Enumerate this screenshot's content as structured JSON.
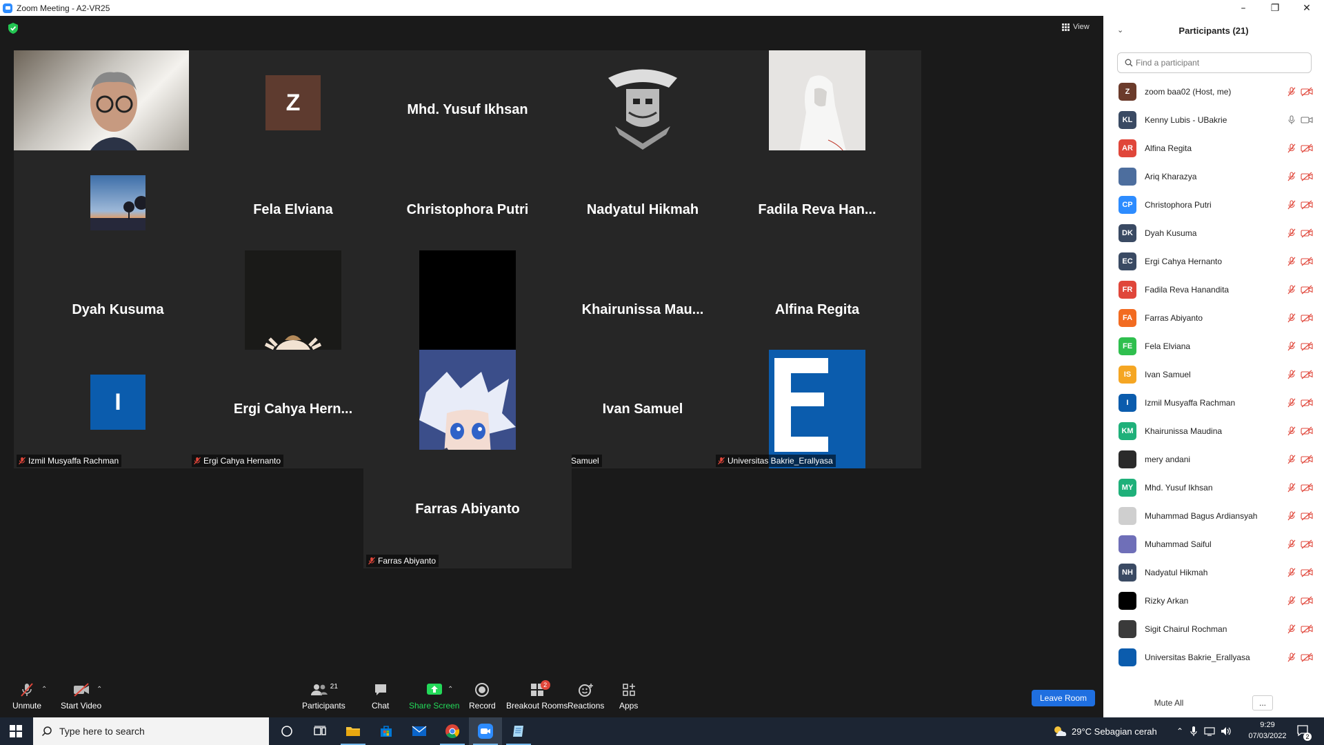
{
  "window": {
    "title": "Zoom Meeting - A2-VR25",
    "controls": [
      "minimize",
      "restore",
      "close"
    ]
  },
  "meeting": {
    "view_label": "View",
    "tiles": [
      {
        "label": "Kenny Lubis - UBakrie",
        "type": "video",
        "active": true,
        "muted": false
      },
      {
        "label": "zoom baa02",
        "type": "letter",
        "letter": "Z",
        "bg": "#5e3b2f",
        "muted": true
      },
      {
        "label": "Mhd. Yusuf Ikhsan",
        "type": "name",
        "display": "Mhd. Yusuf Ikhsan",
        "muted": true
      },
      {
        "label": "Sigit Chairul Rochman",
        "type": "image",
        "image": "samurai-emblem",
        "muted": true
      },
      {
        "label": "Muhammad Bagus Ardiansyah",
        "type": "image",
        "image": "hooded-figure",
        "muted": true
      },
      {
        "label": "Ariq Kharazya",
        "type": "image",
        "image": "sunset-tree",
        "muted": true
      },
      {
        "label": "Fela Elviana",
        "type": "name",
        "display": "Fela Elviana",
        "muted": true
      },
      {
        "label": "Christophora Putri",
        "type": "name",
        "display": "Christophora Putri",
        "muted": true
      },
      {
        "label": "Nadyatul Hikmah",
        "type": "name",
        "display": "Nadyatul Hikmah",
        "muted": true
      },
      {
        "label": "Fadila Reva Hanandita",
        "type": "name",
        "display": "Fadila Reva Han...",
        "muted": true
      },
      {
        "label": "Dyah Kusuma",
        "type": "name",
        "display": "Dyah Kusuma",
        "muted": true
      },
      {
        "label": "mery andani",
        "type": "image",
        "image": "person-selfie",
        "muted": true
      },
      {
        "label": "Rizky Arkan",
        "type": "image",
        "image": "black",
        "muted": true
      },
      {
        "label": "Khairunissa Maudina",
        "type": "name",
        "display": "Khairunissa  Mau...",
        "muted": true
      },
      {
        "label": "Alfina Regita",
        "type": "name",
        "display": "Alfina Regita",
        "muted": true
      },
      {
        "label": "Izmil Musyaffa Rachman",
        "type": "letter",
        "letter": "I",
        "bg": "#0b5cad",
        "muted": true
      },
      {
        "label": "Ergi Cahya Hernanto",
        "type": "name",
        "display": "Ergi Cahya Hern...",
        "muted": true
      },
      {
        "label": "Muhammad Saiful",
        "type": "image",
        "image": "anime-character",
        "muted": true
      },
      {
        "label": "Ivan Samuel",
        "type": "name",
        "display": "Ivan Samuel",
        "muted": true
      },
      {
        "label": "Universitas Bakrie_Erallyasa",
        "type": "image",
        "image": "e-logo",
        "muted": true
      },
      {
        "label": "Farras Abiyanto",
        "type": "name",
        "display": "Farras Abiyanto",
        "muted": true
      }
    ]
  },
  "toolbar": {
    "unmute": "Unmute",
    "start_video": "Start Video",
    "participants": "Participants",
    "participants_count": "21",
    "chat": "Chat",
    "share_screen": "Share Screen",
    "record": "Record",
    "breakout_rooms": "Breakout Rooms",
    "breakout_badge": "2",
    "reactions": "Reactions",
    "apps": "Apps",
    "leave_room": "Leave Room"
  },
  "panel": {
    "title": "Participants (21)",
    "search_placeholder": "Find a participant",
    "mute_all": "Mute All",
    "more": "...",
    "participants": [
      {
        "name": "zoom baa02 (Host, me)",
        "initials": "Z",
        "color": "#6b3b2b",
        "muted": true
      },
      {
        "name": "Kenny Lubis - UBakrie",
        "initials": "KL",
        "color": "#3a4a63",
        "muted": false
      },
      {
        "name": "Alfina Regita",
        "initials": "AR",
        "color": "#e0463a",
        "muted": true
      },
      {
        "name": "Ariq Kharazya",
        "initials": "",
        "color": "#4d6e9e",
        "muted": true
      },
      {
        "name": "Christophora Putri",
        "initials": "CP",
        "color": "#2d8cff",
        "muted": true
      },
      {
        "name": "Dyah Kusuma",
        "initials": "DK",
        "color": "#3a4a63",
        "muted": true
      },
      {
        "name": "Ergi Cahya Hernanto",
        "initials": "EC",
        "color": "#3a4a63",
        "muted": true
      },
      {
        "name": "Fadila Reva Hanandita",
        "initials": "FR",
        "color": "#e0463a",
        "muted": true
      },
      {
        "name": "Farras Abiyanto",
        "initials": "FA",
        "color": "#f26b21",
        "muted": true
      },
      {
        "name": "Fela Elviana",
        "initials": "FE",
        "color": "#2fbf4e",
        "muted": true
      },
      {
        "name": "Ivan Samuel",
        "initials": "IS",
        "color": "#f5a623",
        "muted": true
      },
      {
        "name": "Izmil Musyaffa Rachman",
        "initials": "I",
        "color": "#0b5cad",
        "muted": true
      },
      {
        "name": "Khairunissa Maudina",
        "initials": "KM",
        "color": "#1fb07a",
        "muted": true
      },
      {
        "name": "mery andani",
        "initials": "",
        "color": "#2a2a2a",
        "muted": true
      },
      {
        "name": "Mhd. Yusuf Ikhsan",
        "initials": "MY",
        "color": "#1fb07a",
        "muted": true
      },
      {
        "name": "Muhammad Bagus Ardiansyah",
        "initials": "",
        "color": "#cfcfcf",
        "muted": true
      },
      {
        "name": "Muhammad Saiful",
        "initials": "",
        "color": "#6f6fb8",
        "muted": true
      },
      {
        "name": "Nadyatul Hikmah",
        "initials": "NH",
        "color": "#3a4a63",
        "muted": true
      },
      {
        "name": "Rizky Arkan",
        "initials": "",
        "color": "#000000",
        "muted": true
      },
      {
        "name": "Sigit Chairul Rochman",
        "initials": "",
        "color": "#3a3a3a",
        "muted": true
      },
      {
        "name": "Universitas Bakrie_Erallyasa",
        "initials": "",
        "color": "#0b5cad",
        "muted": true
      }
    ]
  },
  "taskbar": {
    "search_placeholder": "Type here to search",
    "weather": "29°C  Sebagian cerah",
    "time": "9:29",
    "date": "07/03/2022",
    "notifications": "2"
  },
  "colors": {
    "accent": "#2d8cff",
    "mute_red": "#e0463a",
    "active_outline": "#d7e86a",
    "share_green": "#23d959"
  }
}
